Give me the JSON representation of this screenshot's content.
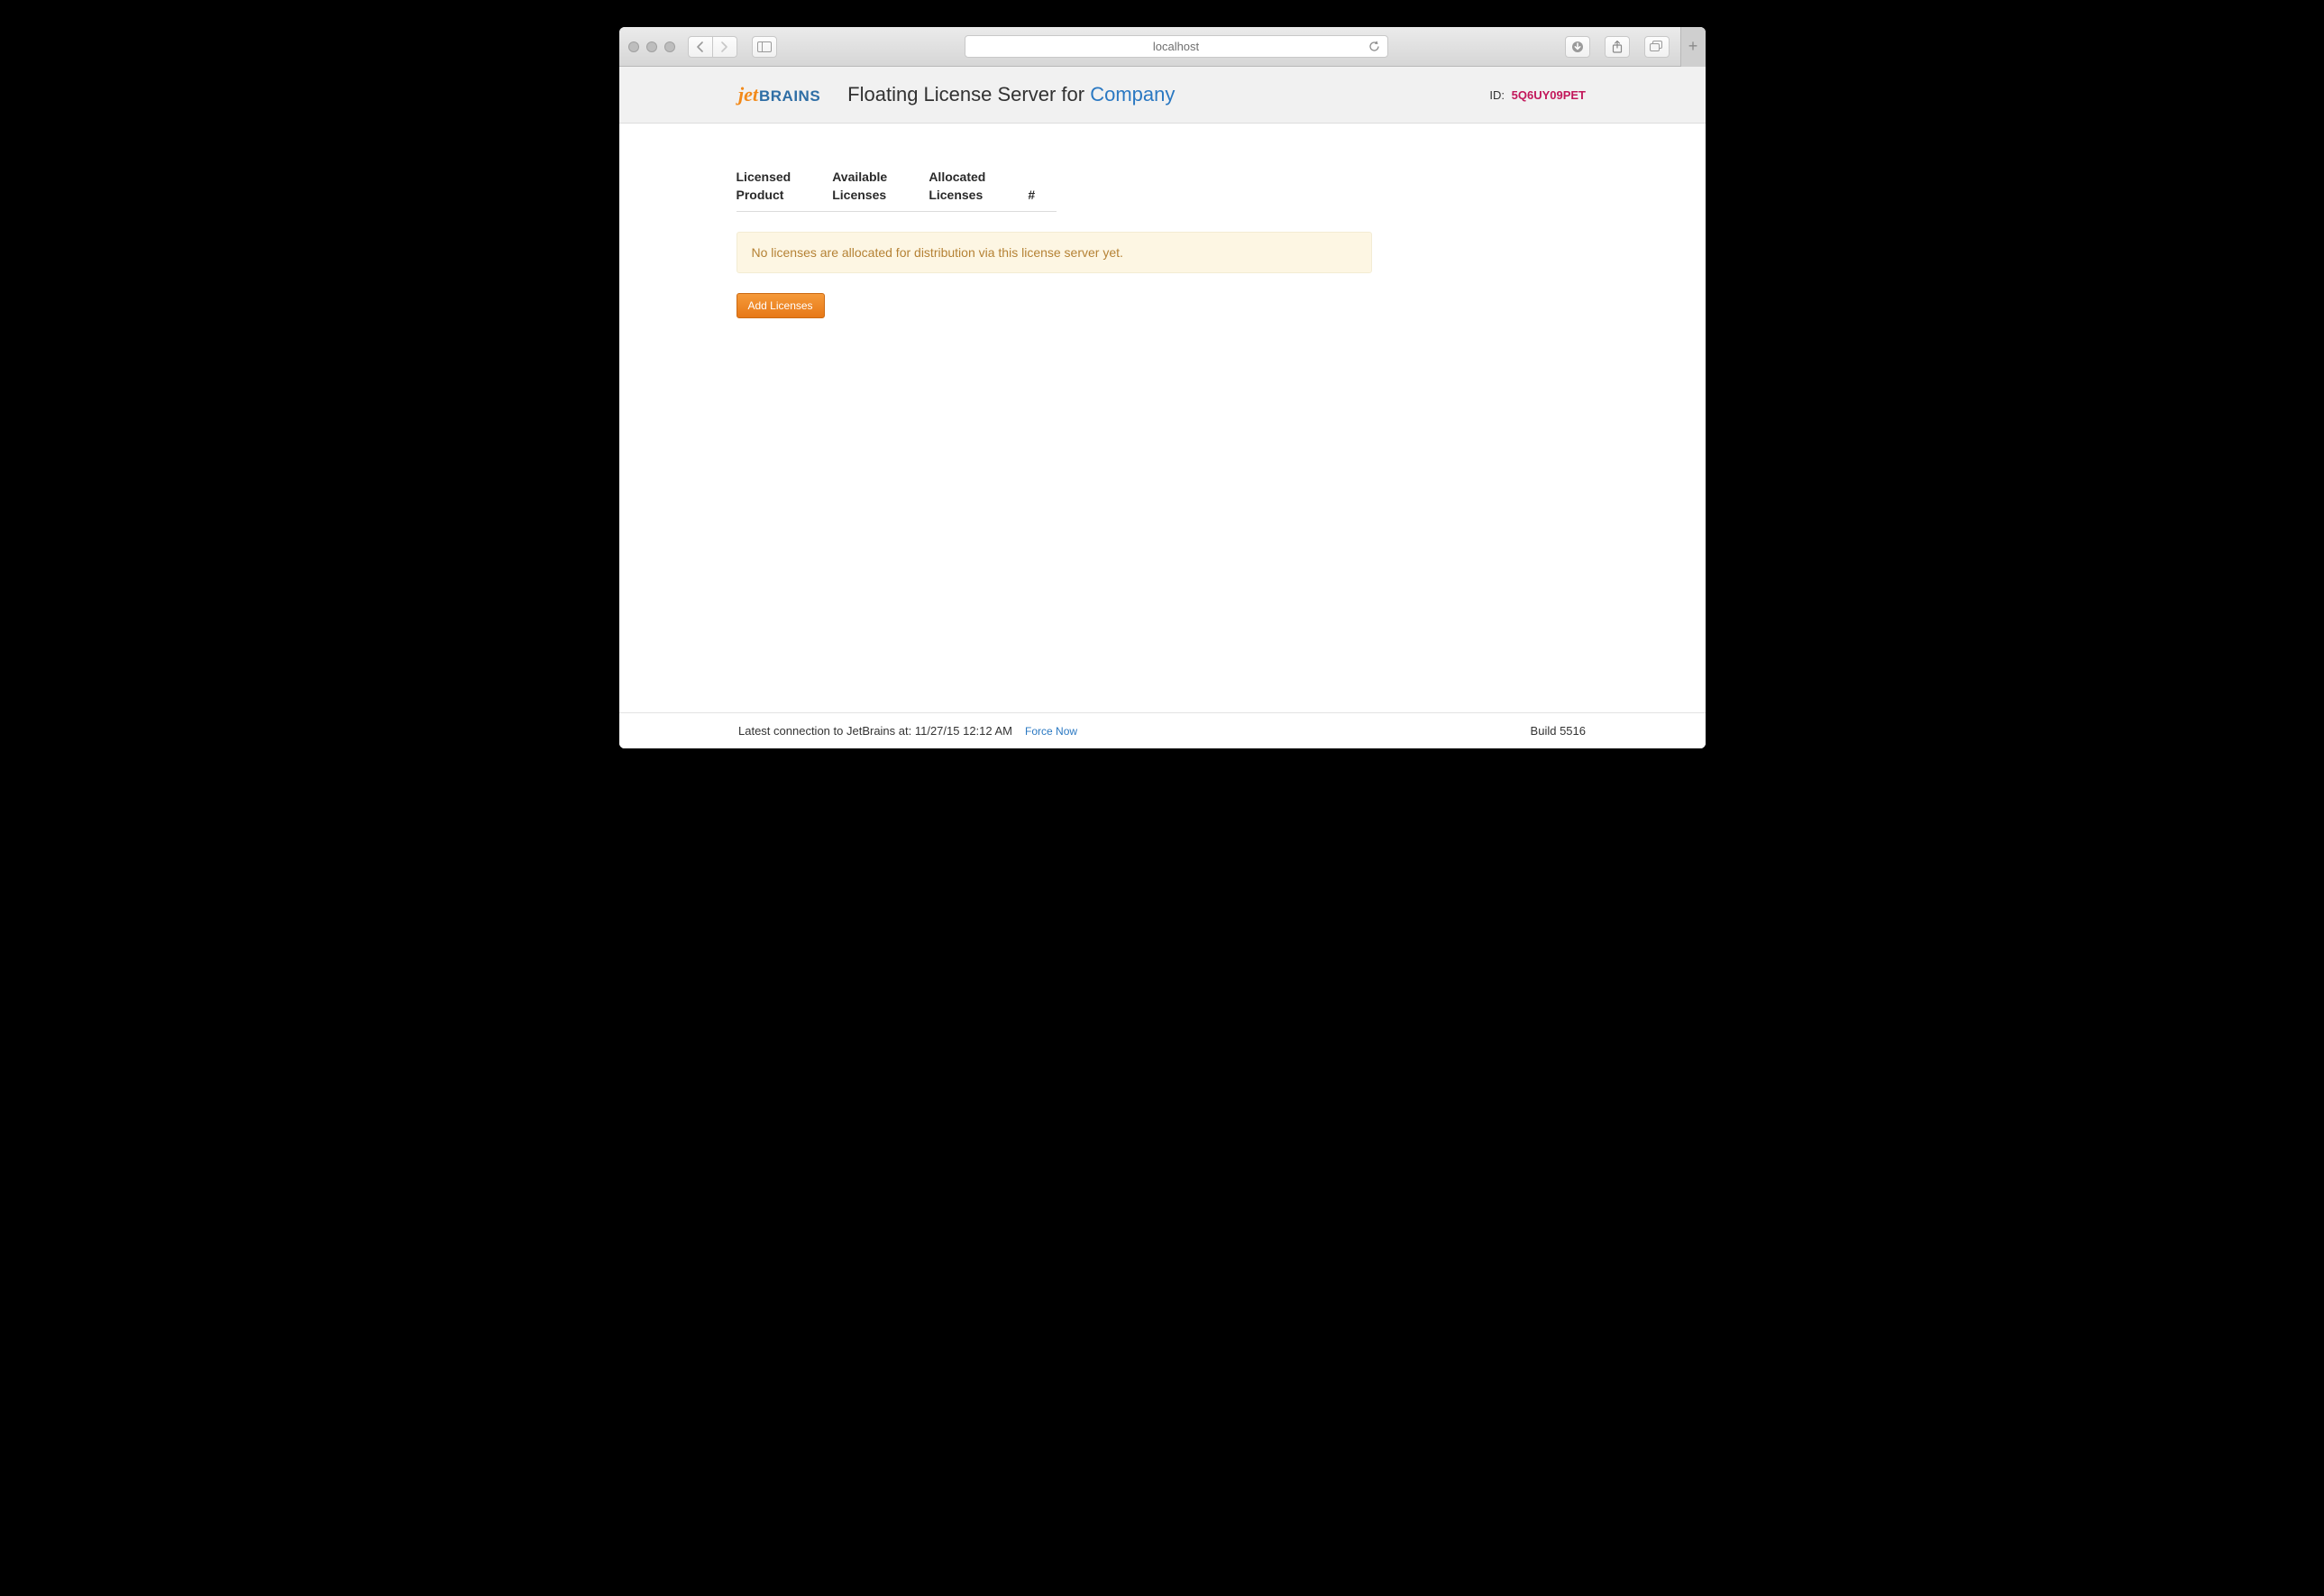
{
  "browser": {
    "address": "localhost"
  },
  "header": {
    "logo_part1": "jet",
    "logo_part2": "BRAINS",
    "title_prefix": "Floating License Server for ",
    "company": "Company",
    "id_label": "ID:",
    "id_value": "5Q6UY09PET"
  },
  "table": {
    "col1_l1": "Licensed",
    "col1_l2": "Product",
    "col2_l1": "Available",
    "col2_l2": "Licenses",
    "col3_l1": "Allocated",
    "col3_l2": "Licenses",
    "col4": "#"
  },
  "alert": "No licenses are allocated for distribution via this license server yet.",
  "buttons": {
    "add": "Add Licenses"
  },
  "footer": {
    "latest": "Latest connection to JetBrains at: 11/27/15 12:12 AM",
    "force": "Force Now",
    "build": "Build 5516"
  }
}
